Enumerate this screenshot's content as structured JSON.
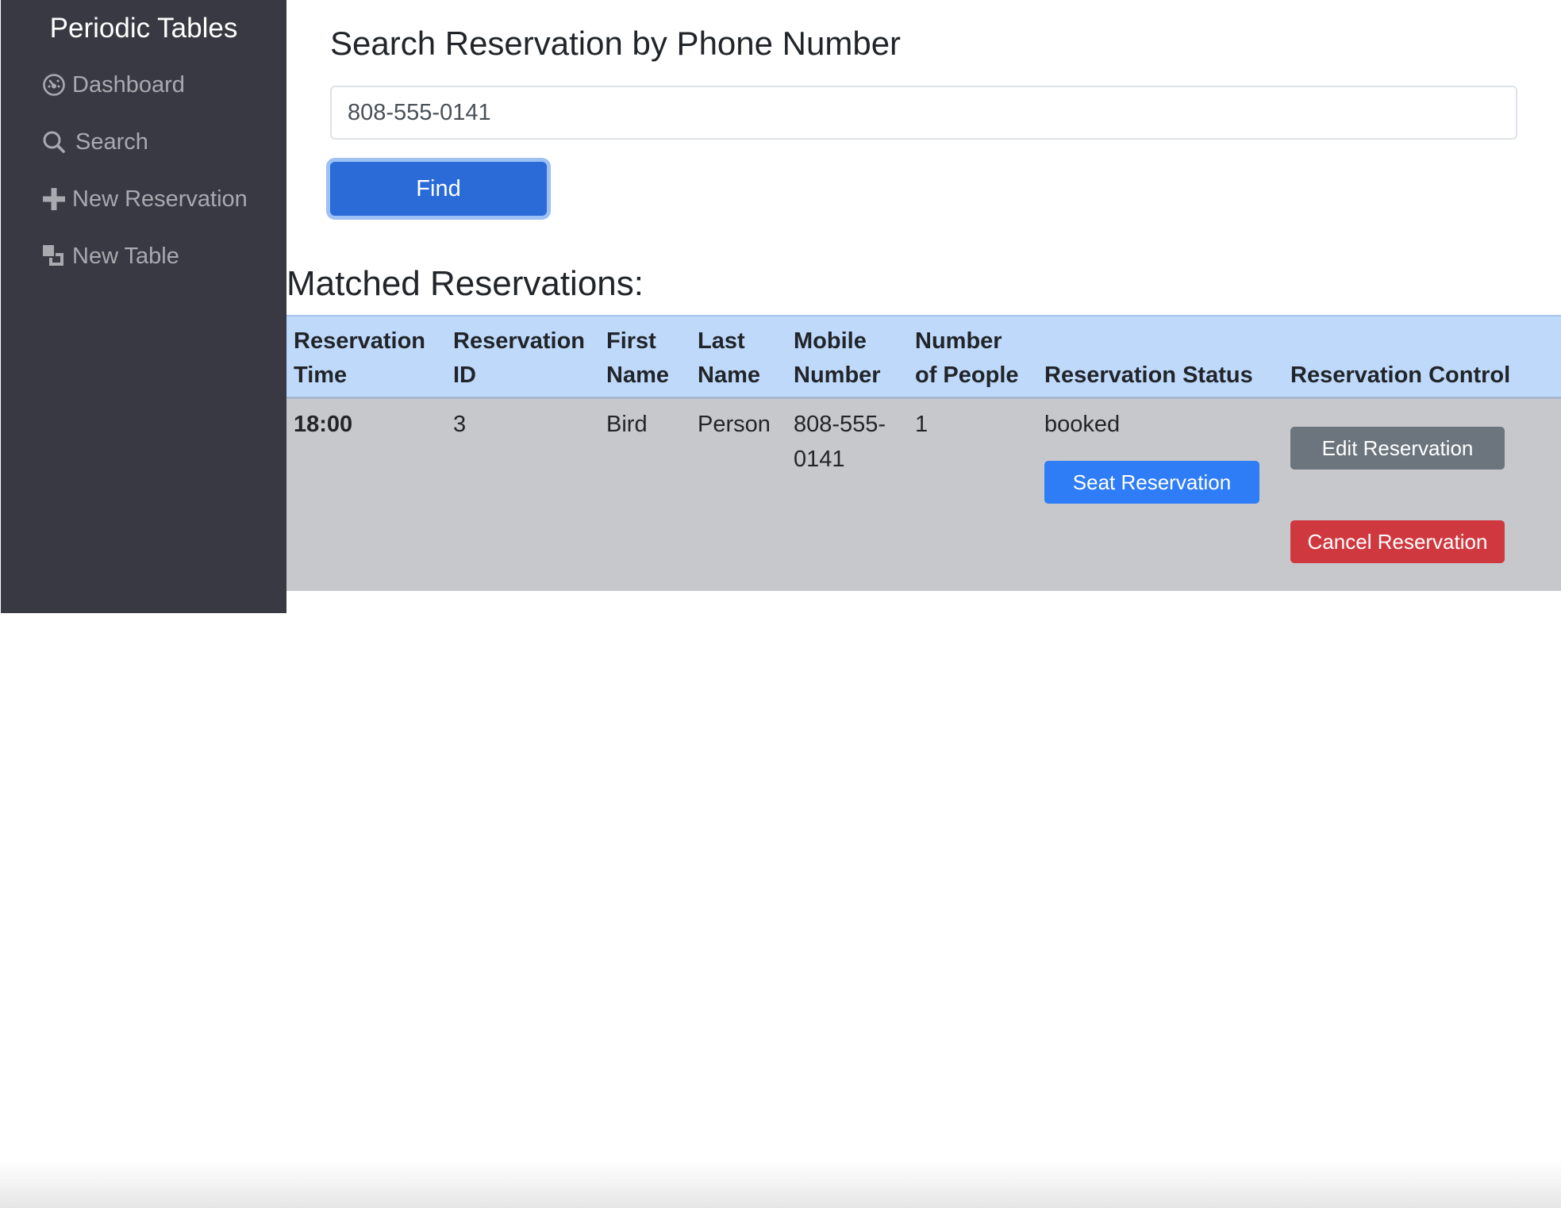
{
  "sidebar": {
    "brand": "Periodic Tables",
    "items": [
      {
        "label": "Dashboard",
        "icon": "dashboard-icon"
      },
      {
        "label": "Search",
        "icon": "search-icon"
      },
      {
        "label": "New Reservation",
        "icon": "plus-icon"
      },
      {
        "label": "New Table",
        "icon": "new-table-icon"
      }
    ]
  },
  "search": {
    "title": "Search Reservation by Phone Number",
    "input_value": "808-555-0141",
    "find_label": "Find"
  },
  "results": {
    "title": "Matched Reservations:",
    "columns": [
      {
        "line1": "Reservation",
        "line2": "Time"
      },
      {
        "line1": "Reservation",
        "line2": "ID"
      },
      {
        "line1": "First",
        "line2": "Name"
      },
      {
        "line1": "Last",
        "line2": "Name"
      },
      {
        "line1": "Mobile",
        "line2": "Number"
      },
      {
        "line1": "Number",
        "line2": "of People"
      },
      {
        "line1": "",
        "line2": "Reservation Status"
      },
      {
        "line1": "",
        "line2": "Reservation Control"
      }
    ],
    "rows": [
      {
        "time": "18:00",
        "id": "3",
        "first_name": "Bird",
        "last_name": "Person",
        "mobile_line1": "808-555-",
        "mobile_line2": "0141",
        "people": "1",
        "status": "booked",
        "seat_label": "Seat Reservation",
        "edit_label": "Edit Reservation",
        "cancel_label": "Cancel Reservation"
      }
    ]
  },
  "colors": {
    "sidebar_bg": "#393943",
    "primary": "#2a6bd8",
    "seat": "#2f7df6",
    "edit": "#6c757d",
    "cancel": "#d0383f",
    "table_header": "#bfd9fb",
    "table_row": "#c7c8cc"
  }
}
